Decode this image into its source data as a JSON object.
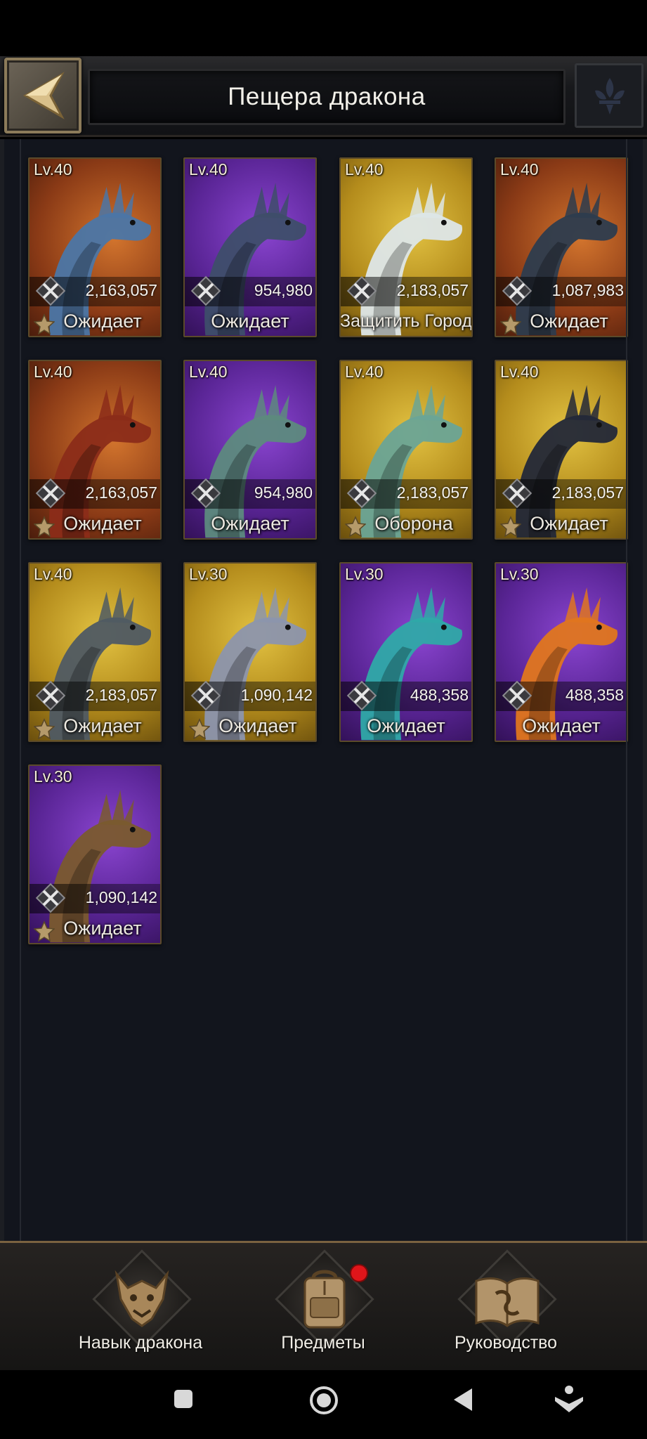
{
  "header": {
    "title": "Пещера дракона",
    "back_icon": "chevron-left-icon",
    "emblem_icon": "fleur-emblem-icon"
  },
  "dragons": [
    {
      "level": "Lv.40",
      "power": "2,163,057",
      "status": "Ожидает",
      "bg": "orange",
      "color": "#4b76a6",
      "starred": true
    },
    {
      "level": "Lv.40",
      "power": "954,980",
      "status": "Ожидает",
      "bg": "purple",
      "color": "#3e4e6a",
      "starred": false
    },
    {
      "level": "Lv.40",
      "power": "2,183,057",
      "status": "Защитить Город",
      "bg": "gold",
      "color": "#dde6e8",
      "starred": false
    },
    {
      "level": "Lv.40",
      "power": "1,087,983",
      "status": "Ожидает",
      "bg": "orange",
      "color": "#2d3c4e",
      "starred": true
    },
    {
      "level": "Lv.40",
      "power": "2,163,057",
      "status": "Ожидает",
      "bg": "orange",
      "color": "#8b2c19",
      "starred": true
    },
    {
      "level": "Lv.40",
      "power": "954,980",
      "status": "Ожидает",
      "bg": "purple",
      "color": "#5d8a7e",
      "starred": false
    },
    {
      "level": "Lv.40",
      "power": "2,183,057",
      "status": "Оборона",
      "bg": "gold",
      "color": "#6aa496",
      "starred": true
    },
    {
      "level": "Lv.40",
      "power": "2,183,057",
      "status": "Ожидает",
      "bg": "gold",
      "color": "#232838",
      "starred": true
    },
    {
      "level": "Lv.40",
      "power": "2,183,057",
      "status": "Ожидает",
      "bg": "gold",
      "color": "#4f5a63",
      "starred": true
    },
    {
      "level": "Lv.30",
      "power": "1,090,142",
      "status": "Ожидает",
      "bg": "gold",
      "color": "#8c95ad",
      "starred": true
    },
    {
      "level": "Lv.30",
      "power": "488,358",
      "status": "Ожидает",
      "bg": "purple",
      "color": "#2fa9a8",
      "starred": false
    },
    {
      "level": "Lv.30",
      "power": "488,358",
      "status": "Ожидает",
      "bg": "purple",
      "color": "#e0761e",
      "starred": false
    },
    {
      "level": "Lv.30",
      "power": "1,090,142",
      "status": "Ожидает",
      "bg": "purple",
      "color": "#7a5a2e",
      "starred": true
    }
  ],
  "bottom_nav": [
    {
      "label": "Навык дракона",
      "icon": "dragon-skill-icon",
      "badge": false
    },
    {
      "label": "Предметы",
      "icon": "backpack-icon",
      "badge": true
    },
    {
      "label": "Руководство",
      "icon": "guide-book-icon",
      "badge": false
    }
  ],
  "system_nav": {
    "icons": [
      "recents-square-icon",
      "home-circle-icon",
      "back-triangle-icon",
      "assistant-icon"
    ]
  },
  "colors": {
    "accent_gold": "#8c7b5a",
    "badge_red": "#e0151a",
    "content_bg": "#12151d"
  }
}
